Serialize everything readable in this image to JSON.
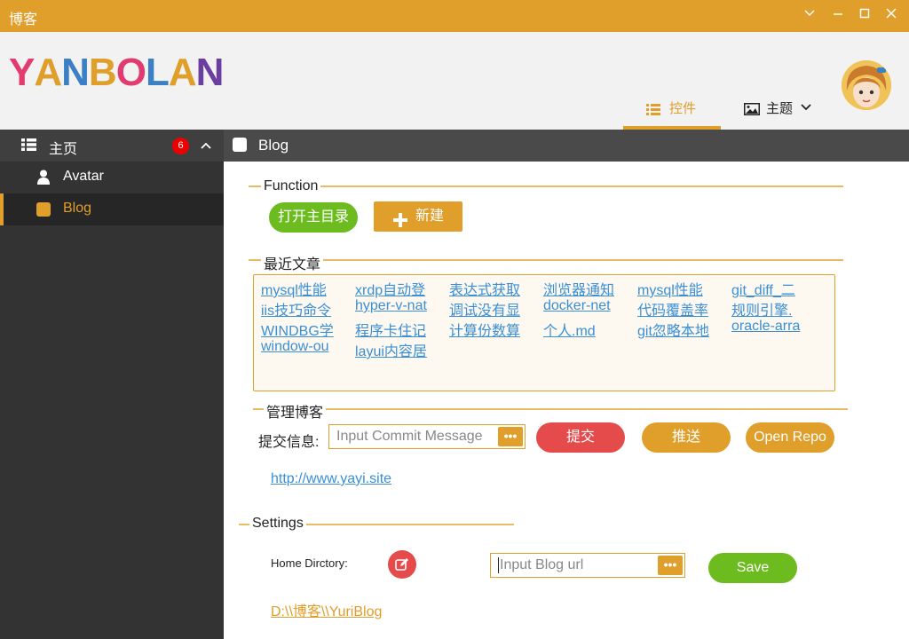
{
  "window": {
    "title": "博客"
  },
  "header": {
    "logo_letters": [
      "Y",
      "A",
      "N",
      "B",
      "O",
      "L",
      "A",
      "N"
    ],
    "logo_colors": [
      "#e13b6f",
      "#e09e2a",
      "#3b7fc4",
      "#e09e2a",
      "#e13b6f",
      "#3b7fc4",
      "#e09e2a",
      "#6b3fa0"
    ],
    "tabs": [
      {
        "label": "控件",
        "icon": "list-icon"
      },
      {
        "label": "主题",
        "icon": "image-icon"
      }
    ]
  },
  "sidebar": {
    "head_label": "主页",
    "badge": "6",
    "items": [
      {
        "label": "Avatar",
        "icon": "user-icon"
      },
      {
        "label": "Blog",
        "icon": "square-icon"
      }
    ]
  },
  "content": {
    "title": "Blog",
    "function": {
      "legend": "Function",
      "open_dir_label": "打开主目录",
      "new_label": "新建"
    },
    "recent": {
      "legend": "最近文章",
      "articles": [
        "mysql性能",
        "xrdp自动登",
        "表达式获取",
        "浏览器通知",
        "mysql性能",
        "git_diff_二",
        "iis技巧命令",
        "hyper-v-nat",
        "调试没有显",
        "docker-net",
        "代码覆盖率",
        "规则引擎.",
        "WINDBG学",
        "程序卡住记",
        "计算份数算",
        "个人.md",
        "git忽略本地",
        "oracle-arra",
        "window-ou",
        "layui内容居"
      ]
    },
    "manage": {
      "legend": "管理博客",
      "commit_label": "提交信息:",
      "commit_placeholder": "Input Commit Message",
      "dots": "•••",
      "submit_label": "提交",
      "push_label": "推送",
      "open_repo_label": "Open Repo",
      "site_url": "http://www.yayi.site"
    },
    "settings": {
      "legend": "Settings",
      "home_dir_label": "Home Dirctory:",
      "blog_url_placeholder": "Input Blog url",
      "dots": "•••",
      "save_label": "Save",
      "home_path": "D:\\\\博客\\\\YuriBlog"
    }
  },
  "colors": {
    "accent": "#e09e2a",
    "green": "#6cbb1f",
    "red": "#e54b4b",
    "link": "#3a8fd6"
  }
}
